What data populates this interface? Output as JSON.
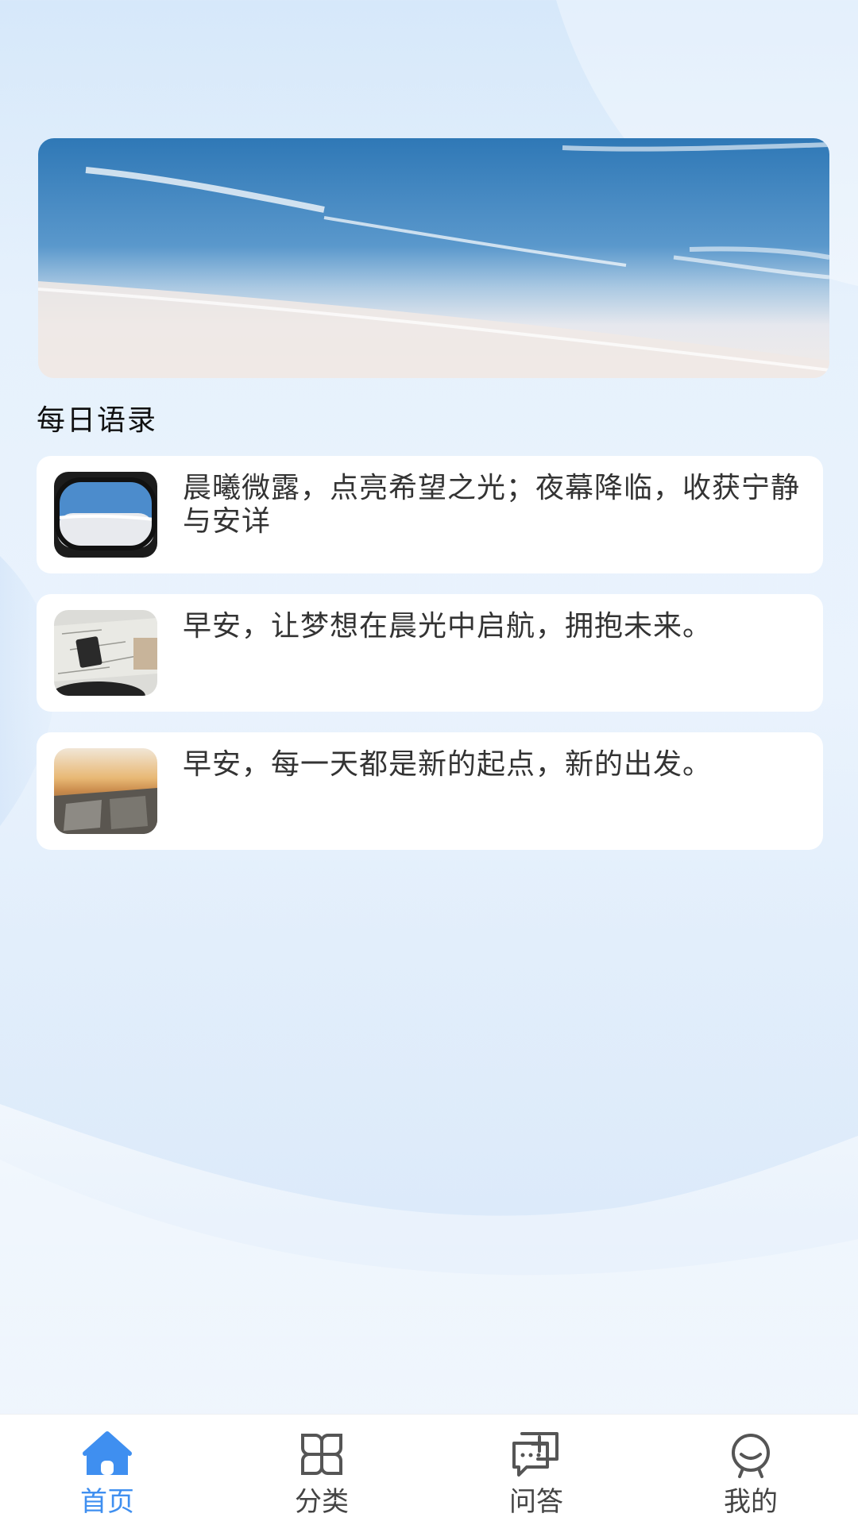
{
  "section": {
    "title": "每日语录"
  },
  "quotes": [
    {
      "text": "晨曦微露，点亮希望之光；夜幕降临，收获宁静与安详",
      "thumb": "airplane-window-sky"
    },
    {
      "text": "早安，让梦想在晨光中启航，拥抱未来。",
      "thumb": "travel-map-passport"
    },
    {
      "text": "早安，每一天都是新的起点，新的出发。",
      "thumb": "sunset-map"
    }
  ],
  "tabbar": {
    "tabs": [
      {
        "label": "首页",
        "icon": "home-icon",
        "active": true
      },
      {
        "label": "分类",
        "icon": "category-icon",
        "active": false
      },
      {
        "label": "问答",
        "icon": "qa-icon",
        "active": false
      },
      {
        "label": "我的",
        "icon": "profile-icon",
        "active": false
      }
    ]
  },
  "colors": {
    "accent": "#3f8ff0",
    "inactive": "#444444",
    "card": "#ffffff"
  }
}
